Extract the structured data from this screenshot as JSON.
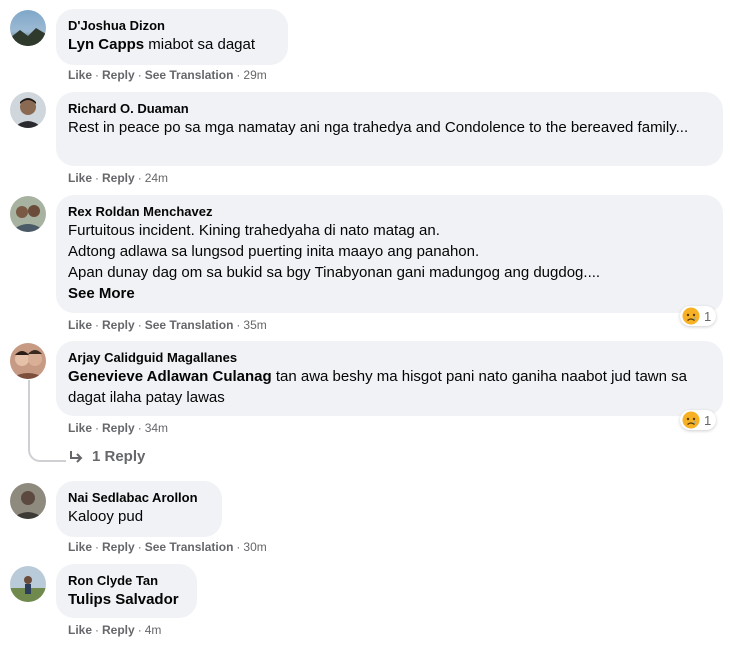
{
  "comments": [
    {
      "author": "D'Joshua Dizon",
      "mention": "Lyn Capps",
      "text": " miabot sa dagat",
      "actions": {
        "like": "Like",
        "reply": "Reply",
        "translate": "See Translation",
        "time": "29m"
      }
    },
    {
      "author": "Richard O. Duaman",
      "text": "Rest in peace po sa mga namatay ani nga trahedya and Condolence to the bereaved family...",
      "actions": {
        "like": "Like",
        "reply": "Reply",
        "time": "24m"
      }
    },
    {
      "author": "Rex Roldan Menchavez",
      "lines": [
        "Furtuitous incident. Kining trahedyaha di nato matag an.",
        "Adtong adlawa sa lungsod puerting inita maayo ang panahon.",
        "Apan dunay dag om sa bukid sa bgy Tinabyonan gani madungog ang dugdog...."
      ],
      "see_more": "See More",
      "reaction_count": "1",
      "actions": {
        "like": "Like",
        "reply": "Reply",
        "translate": "See Translation",
        "time": "35m"
      }
    },
    {
      "author": "Arjay Calidguid Magallanes",
      "mention": "Genevieve Adlawan Culanag",
      "text": " tan awa beshy ma hisgot pani nato ganiha naabot jud tawn sa dagat ilaha patay lawas",
      "reaction_count": "1",
      "actions": {
        "like": "Like",
        "reply": "Reply",
        "time": "34m"
      },
      "replies_label": "1 Reply"
    },
    {
      "author": "Nai Sedlabac Arollon",
      "text": "Kalooy pud",
      "actions": {
        "like": "Like",
        "reply": "Reply",
        "translate": "See Translation",
        "time": "30m"
      }
    },
    {
      "author": "Ron Clyde Tan",
      "mention": "Tulips Salvador",
      "actions": {
        "like": "Like",
        "reply": "Reply",
        "time": "4m"
      }
    }
  ],
  "colors": {
    "bubble": "#f0f2f5",
    "meta": "#65676b",
    "text": "#050505"
  },
  "icons": {
    "reaction": "sad-face-icon",
    "reply_arrow": "reply-arrow-icon"
  }
}
